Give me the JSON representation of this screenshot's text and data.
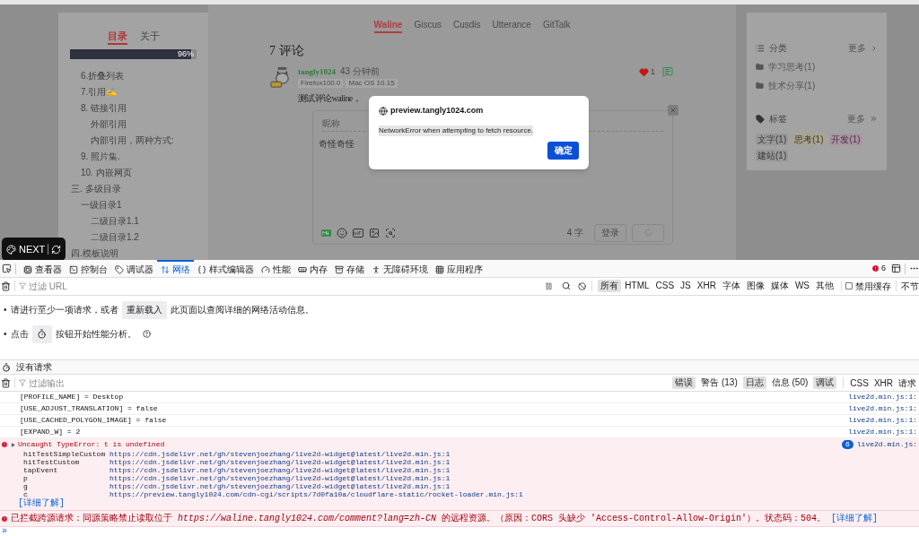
{
  "page": {
    "toc_tabs": [
      {
        "label": "目录",
        "selected": true
      },
      {
        "label": "关于",
        "selected": false
      }
    ],
    "progress": {
      "level": 0.96,
      "reading": "96%"
    },
    "toc_continued": [
      {
        "label": "6.折叠列表"
      },
      {
        "label": "7.引用✍"
      },
      {
        "label": "8. 链接引用",
        "children": [
          {
            "label": "外部引用"
          },
          {
            "label": "内部引用，两种方式:"
          }
        ]
      },
      {
        "label": "9. 照片集."
      },
      {
        "label": "10. 内嵌网页"
      }
    ],
    "toc": [
      {
        "label": "三. 多级目录",
        "children": [
          {
            "label": "一级目录1",
            "children": [
              {
                "label": "二级目录1.1"
              },
              {
                "label": "二级目录1.2"
              }
            ]
          }
        ]
      },
      {
        "label": "四.模板说明"
      }
    ],
    "comment_tabs": [
      {
        "label": "Waline",
        "selected": true
      },
      {
        "label": "Giscus",
        "selected": false
      },
      {
        "label": "Cusdis",
        "selected": false
      },
      {
        "label": "Utterance",
        "selected": false
      },
      {
        "label": "GitTalk",
        "selected": false
      }
    ],
    "comment_count": "7 评论",
    "comment": {
      "author": "tangly1024",
      "time": "43 分钟前",
      "badges": [
        "Firefox100.0",
        "Mac OS 10.15"
      ],
      "likes": "1",
      "liked": true,
      "text": "测试评论waline，"
    },
    "editor": {
      "nickname_placeholder": "昵称",
      "value": "奇怪奇怪",
      "word_count": "4 字",
      "login": "登录"
    },
    "categories": {
      "title": "分类",
      "more": "更多",
      "items": [
        "学习思考(1)",
        "技术分享(1)"
      ]
    },
    "tags": {
      "title": "标签",
      "more": "更多",
      "items": [
        {
          "label": "文字(1)",
          "color": "#989898"
        },
        {
          "label": "思考(1)",
          "color": "#aaa48e"
        },
        {
          "label": "开发(1)",
          "color": "#ad92a4"
        },
        {
          "label": "建站(1)",
          "color": "#989898"
        }
      ]
    },
    "theme_switch": {
      "label": "NEXT"
    },
    "dialog": {
      "origin": "preview.tangly1024.com",
      "message": "NetworkError when attempting to fetch resource.",
      "button": "确定"
    }
  },
  "devtools": {
    "tabs": [
      {
        "label": "查看器",
        "selected": false
      },
      {
        "label": "控制台",
        "selected": false
      },
      {
        "label": "调试器",
        "selected": false
      },
      {
        "label": "网络",
        "selected": true
      },
      {
        "label": "样式编辑器",
        "selected": false
      },
      {
        "label": "性能",
        "selected": false
      },
      {
        "label": "内存",
        "selected": false
      },
      {
        "label": "存储",
        "selected": false
      },
      {
        "label": "无障碍环境",
        "selected": false
      },
      {
        "label": "应用程序",
        "selected": false
      }
    ],
    "error_count": "6",
    "url_filter": {
      "placeholder": "过滤 URL"
    },
    "types": [
      {
        "label": "所有",
        "selected": true
      },
      {
        "label": "HTML",
        "selected": false
      },
      {
        "label": "CSS",
        "selected": false
      },
      {
        "label": "JS",
        "selected": false
      },
      {
        "label": "XHR",
        "selected": false
      },
      {
        "label": "字体",
        "selected": false
      },
      {
        "label": "图像",
        "selected": false
      },
      {
        "label": "媒体",
        "selected": false
      },
      {
        "label": "WS",
        "selected": false
      },
      {
        "label": "其他",
        "selected": false
      }
    ],
    "disable_cache": {
      "label": "禁用缓存",
      "checked": false
    },
    "throttle": "不节",
    "hints": [
      {
        "bullet": "•",
        "before": "请进行至少一项请求，或者",
        "button": "重新载入",
        "after": "此页面以查阅详细的网络活动信息。"
      },
      {
        "bullet": "•",
        "before": "点击",
        "after": "按钮开始性能分析。"
      }
    ],
    "status": "没有请求",
    "console": {
      "filter": {
        "placeholder": "过滤输出"
      },
      "levels": [
        {
          "label": "错误",
          "selected": true
        },
        {
          "label": "警告 (13)",
          "selected": false
        },
        {
          "label": "日志",
          "selected": true
        },
        {
          "label": "信息 (50)",
          "selected": false
        },
        {
          "label": "调试",
          "selected": true
        }
      ],
      "extra_filters": [
        "CSS",
        "XHR",
        "请求"
      ],
      "messages": [
        {
          "kind": "log",
          "text": "[PROFILE_NAME] = Desktop",
          "source": "live2d.min.js:1:"
        },
        {
          "kind": "log",
          "text": "[USE_ADJUST_TRANSLATION] = false",
          "source": "live2d.min.js:1:"
        },
        {
          "kind": "log",
          "text": "[USE_CACHED_POLYGON_IMAGE] = false",
          "source": "live2d.min.js:1:"
        },
        {
          "kind": "log",
          "text": "[EXPAND_W] = 2",
          "source": "live2d.min.js:1:"
        },
        {
          "kind": "error",
          "text": "Uncaught TypeError: t is undefined",
          "count": "6",
          "source": "live2d.min.js:",
          "stack": [
            {
              "fn": "hitTestSimpleCustom",
              "url": "https://cdn.jsdelivr.net/gh/stevenjoezhang/live2d-widget@latest/live2d.min.js:1"
            },
            {
              "fn": "hitTestCustom",
              "url": "https://cdn.jsdelivr.net/gh/stevenjoezhang/live2d-widget@latest/live2d.min.js:1"
            },
            {
              "fn": "tapEvent",
              "url": "https://cdn.jsdelivr.net/gh/stevenjoezhang/live2d-widget@latest/live2d.min.js:1"
            },
            {
              "fn": "p",
              "url": "https://cdn.jsdelivr.net/gh/stevenjoezhang/live2d-widget@latest/live2d.min.js:1"
            },
            {
              "fn": "g",
              "url": "https://cdn.jsdelivr.net/gh/stevenjoezhang/live2d-widget@latest/live2d.min.js:1"
            },
            {
              "fn": "c",
              "url": "https://preview.tangly1024.com/cdn-cgi/scripts/7d0fa10a/cloudflare-static/rocket-loader.min.js:1"
            }
          ],
          "link": "[详细了解]"
        },
        {
          "kind": "error",
          "text": "已拦截跨源请求：同源策略禁止读取位于 *https://waline.tangly1024.com/comment?lang=zh-CN* 的远程资源。（原因：CORS 头缺少 'Access-Control-Allow-Origin'）。状态码：504。",
          "link": "[详细了解]"
        }
      ],
      "prompt": "»"
    }
  }
}
